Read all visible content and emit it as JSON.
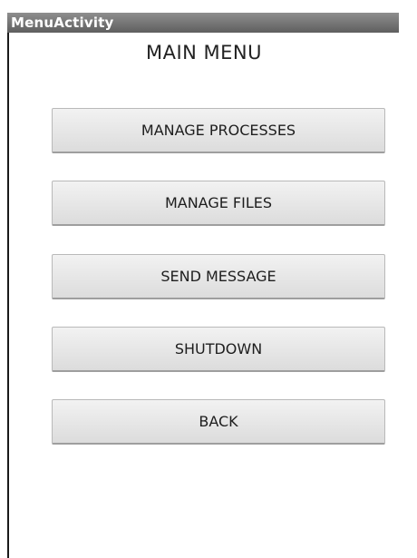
{
  "window": {
    "title": "MenuActivity"
  },
  "main": {
    "heading": "MAIN MENU",
    "buttons": [
      {
        "label": "MANAGE PROCESSES"
      },
      {
        "label": "MANAGE FILES"
      },
      {
        "label": "SEND MESSAGE"
      },
      {
        "label": "SHUTDOWN"
      },
      {
        "label": "BACK"
      }
    ]
  }
}
